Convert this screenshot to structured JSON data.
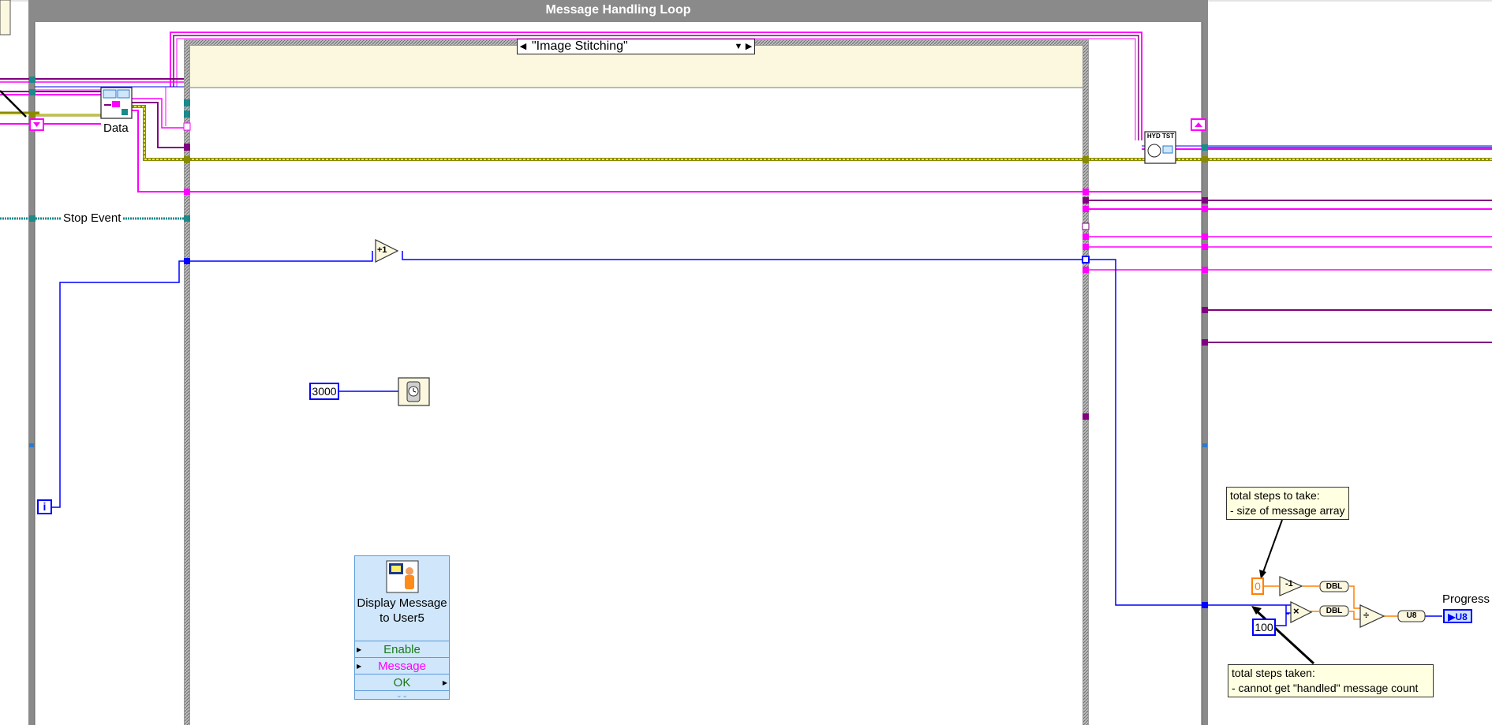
{
  "loop": {
    "title": "Message Handling Loop",
    "iteration_terminal": "i"
  },
  "case_structure": {
    "selected_case": "\"Image Stitching\""
  },
  "nodes": {
    "data_label": "Data",
    "stop_event_label": "Stop Event",
    "increment_label": "+1",
    "wait_constant": "3000",
    "decrement_label": "-1",
    "zero_constant": "0",
    "hundred_constant": "100",
    "dbl_1": "DBL",
    "dbl_2": "DBL",
    "u8_convert": "U8",
    "multiply": "×",
    "divide": "÷",
    "hyd_tst_label": "HYD TST",
    "progress_indicator_type": "U8",
    "progress_label": "Progress"
  },
  "express_vi": {
    "title": "Display Message to User5",
    "enable": "Enable",
    "message": "Message",
    "ok": "OK"
  },
  "notes": {
    "steps_to_take_line1": "total steps to take:",
    "steps_to_take_line2": "- size of message array",
    "steps_taken_line1": "total steps taken:",
    "steps_taken_line2": "- cannot get \"handled\" message count"
  },
  "colors": {
    "loop_border": "#8a8a8a",
    "case_border": "#5a5a5a",
    "case_top_bg": "#fbf8df",
    "wire_pink": "#ff00ff",
    "wire_purple": "#800080",
    "wire_yellow": "#8a8a00",
    "wire_blue": "#0000ff",
    "wire_teal": "#1a8a8a",
    "wire_orange": "#ff8000",
    "express_bg": "#cfe6fb",
    "enable_color": "#1a7a1a",
    "message_color": "#ff00ff",
    "ok_color": "#1a7a1a"
  },
  "icons": [
    "unbundle-icon",
    "clock-wait-icon",
    "message-dialog-icon",
    "hyd-tst-subvi-icon",
    "tunnel-icon"
  ]
}
